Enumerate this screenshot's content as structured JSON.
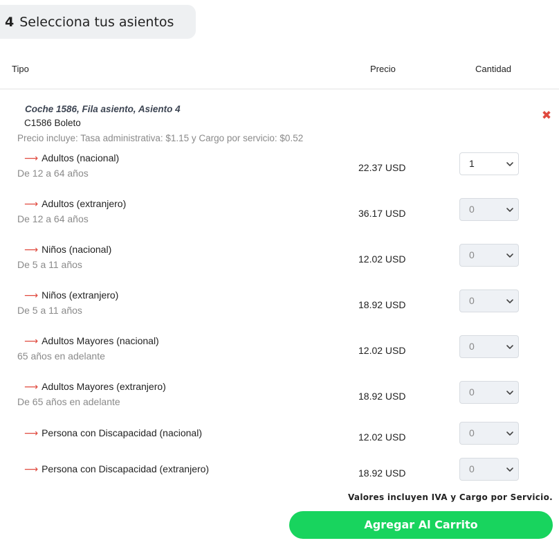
{
  "step": {
    "number": "4",
    "title": "Selecciona tus asientos"
  },
  "table_header": {
    "type": "Tipo",
    "price": "Precio",
    "quantity": "Cantidad"
  },
  "seat": {
    "coach": "Coche 1586, Fila asiento, Asiento 4",
    "code": "C1586 Boleto",
    "price_note": "Precio incluye: Tasa administrativa: $1.15 y Cargo por servicio: $0.52",
    "remove_icon": "✖"
  },
  "rows": [
    {
      "label": "Adultos (nacional)",
      "sub": "De 12 a 64 años",
      "price": "22.37 USD",
      "qty": "1"
    },
    {
      "label": "Adultos (extranjero)",
      "sub": "De 12 a 64 años",
      "price": "36.17 USD",
      "qty": "0"
    },
    {
      "label": "Niños (nacional)",
      "sub": "De 5 a 11 años",
      "price": "12.02 USD",
      "qty": "0"
    },
    {
      "label": "Niños (extranjero)",
      "sub": "De 5 a 11 años",
      "price": "18.92 USD",
      "qty": "0"
    },
    {
      "label": "Adultos Mayores (nacional)",
      "sub": "65 años en adelante",
      "price": "12.02 USD",
      "qty": "0"
    },
    {
      "label": "Adultos Mayores (extranjero)",
      "sub": "De 65 años en adelante",
      "price": "18.92 USD",
      "qty": "0"
    },
    {
      "label": "Persona con Discapacidad (nacional)",
      "sub": "",
      "price": "12.02 USD",
      "qty": "0"
    },
    {
      "label": "Persona con Discapacidad (extranjero)",
      "sub": "",
      "price": "18.92 USD",
      "qty": "0"
    }
  ],
  "footer": {
    "vat_note": "Valores incluyen IVA y Cargo por Servicio.",
    "add_to_cart": "Agregar Al Carrito"
  },
  "colors": {
    "accent_green": "#18d45e",
    "arrow_red": "#e04a3f"
  }
}
